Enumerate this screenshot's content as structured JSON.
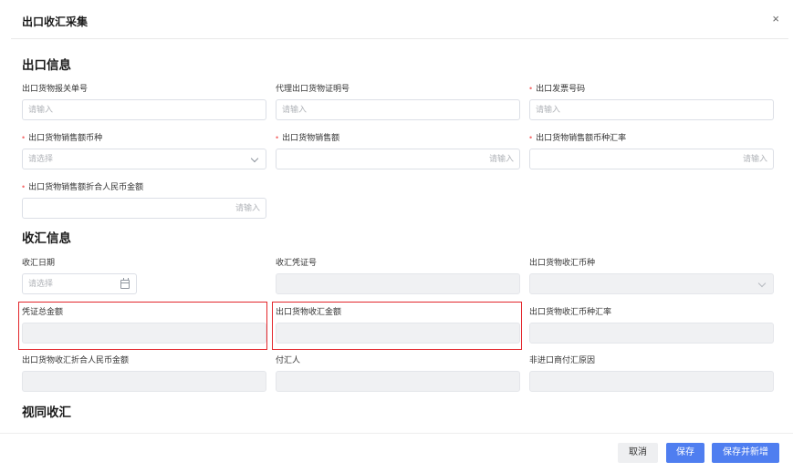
{
  "dialog": {
    "title": "出口收汇采集",
    "close_icon": "×"
  },
  "export_info": {
    "title": "出口信息",
    "fields": [
      {
        "label": "出口货物报关单号",
        "required": false,
        "placeholder": "请输入"
      },
      {
        "label": "代理出口货物证明号",
        "required": false,
        "placeholder": "请输入"
      },
      {
        "label": "出口发票号码",
        "required": true,
        "placeholder": "请输入"
      },
      {
        "label": "出口货物销售额币种",
        "required": true,
        "placeholder": "请选择"
      },
      {
        "label": "出口货物销售额",
        "required": true,
        "placeholder": "请输入"
      },
      {
        "label": "出口货物销售额币种汇率",
        "required": true,
        "placeholder": "请输入"
      },
      {
        "label": "出口货物销售额折合人民币金额",
        "required": true,
        "placeholder": "请输入"
      }
    ]
  },
  "collection_info": {
    "title": "收汇信息",
    "fields": [
      {
        "label": "收汇日期",
        "placeholder": "请选择"
      },
      {
        "label": "收汇凭证号"
      },
      {
        "label": "出口货物收汇币种"
      },
      {
        "label": "凭证总金额"
      },
      {
        "label": "出口货物收汇金额"
      },
      {
        "label": "出口货物收汇币种汇率"
      },
      {
        "label": "出口货物收汇折合人民币金额"
      },
      {
        "label": "付汇人"
      },
      {
        "label": "非进口商付汇原因"
      }
    ]
  },
  "deemed_collection": {
    "title": "视同收汇"
  },
  "footer": {
    "cancel_label": "取消",
    "save_label": "保存",
    "save_new_label": "保存并新增"
  },
  "colors": {
    "primary": "#4f7ef0",
    "required": "#f56c6c",
    "highlight": "#e3262b",
    "disabled_bg": "#f0f1f3"
  }
}
